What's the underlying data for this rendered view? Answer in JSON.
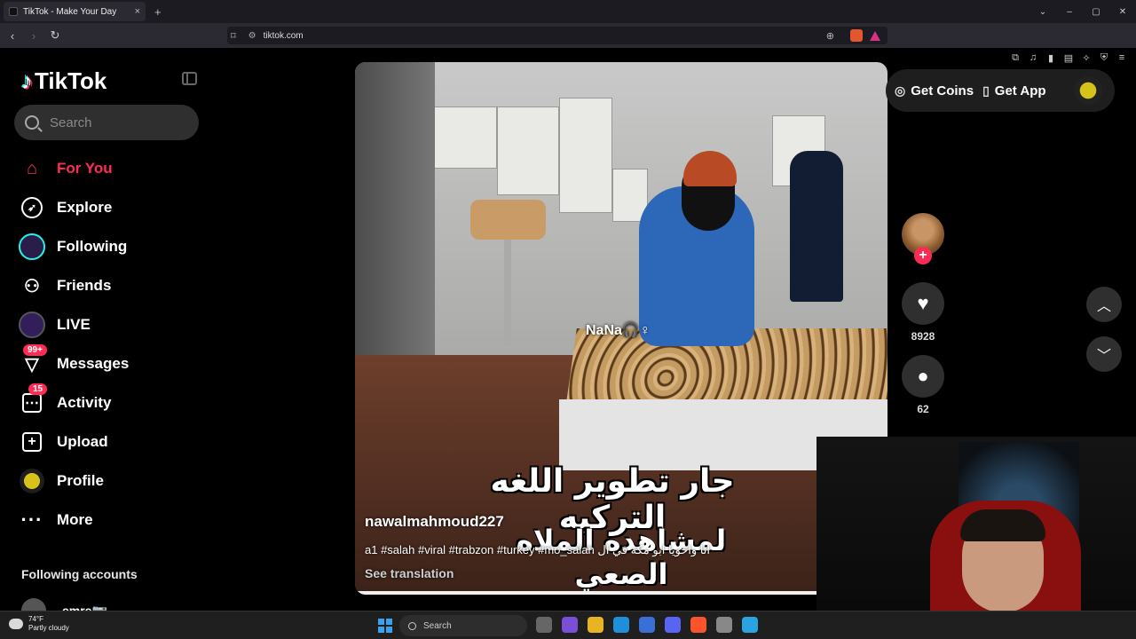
{
  "browser": {
    "tab_title": "TikTok - Make Your Day",
    "tab_close": "×",
    "new_tab": "+",
    "url": "tiktok.com",
    "window_controls": [
      "⌄",
      "–",
      "▢",
      "✕"
    ]
  },
  "sidebar": {
    "logo_text": "TikTok",
    "search_placeholder": "Search",
    "nav": [
      {
        "label": "For You",
        "icon": "home-icon"
      },
      {
        "label": "Explore",
        "icon": "compass-icon"
      },
      {
        "label": "Following",
        "icon": "following-avatar-icon"
      },
      {
        "label": "Friends",
        "icon": "friends-icon"
      },
      {
        "label": "LIVE",
        "icon": "live-avatar-icon"
      },
      {
        "label": "Messages",
        "icon": "messages-icon",
        "badge": "99+"
      },
      {
        "label": "Activity",
        "icon": "activity-icon",
        "badge": "15"
      },
      {
        "label": "Upload",
        "icon": "upload-icon"
      },
      {
        "label": "Profile",
        "icon": "profile-avatar-icon"
      },
      {
        "label": "More",
        "icon": "more-icon"
      }
    ],
    "following_title": "Following accounts",
    "following_accounts": [
      {
        "name": "emre📷"
      }
    ]
  },
  "video": {
    "watermark": "NaNa🎧♀",
    "overlay_text_top": "جار تطوير اللغه التركيه",
    "overlay_text_bottom": "لمشاهده الملاه الصعي",
    "author": "nawalmahmoud227",
    "caption": "انا واخويا ابو مكة في ال a1 #salah #viral #trabzon #turkey #mo_salah",
    "see_translation": "See translation",
    "progress": 0.87
  },
  "actions": {
    "likes": "8928",
    "comments": "62",
    "follow_plus": "+"
  },
  "top_right": {
    "get_coins": "Get Coins",
    "get_app": "Get App"
  },
  "taskbar": {
    "temp": "74°F",
    "weather": "Partly cloudy",
    "search": "Search"
  },
  "colors": {
    "accent": "#fe2c55",
    "cyan": "#25f4ee"
  }
}
